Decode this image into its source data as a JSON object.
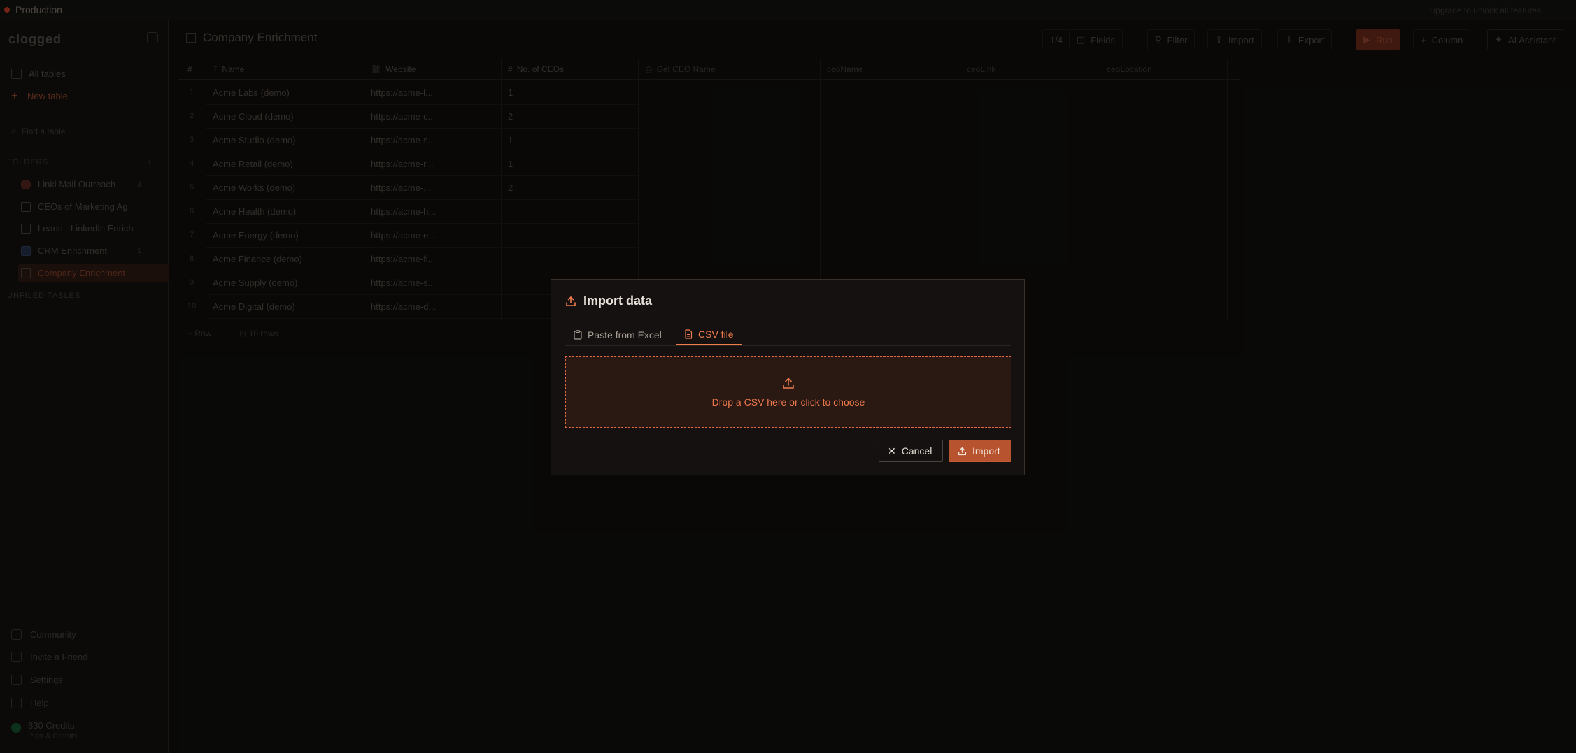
{
  "topbar": {
    "env": "Production",
    "right_info": "Upgrade to unlock all features"
  },
  "sidebar": {
    "logo": "clogged",
    "nav": [
      {
        "label": "All tables"
      },
      {
        "label": "New table",
        "icon": "+"
      }
    ],
    "search_placeholder": "Find a table",
    "folders_label": "FOLDERS",
    "folders": [
      {
        "label": "Linki Mail Outreach",
        "count": "3"
      },
      {
        "label": "CEOs of Marketing Ag"
      },
      {
        "label": "Leads - LinkedIn Enrich"
      },
      {
        "label": "CRM Enrichment",
        "count": "1"
      },
      {
        "label": "Company Enrichment"
      }
    ],
    "unfiled_label": "UNFILED TABLES",
    "bottom": [
      {
        "label": "Community"
      },
      {
        "label": "Invite a Friend"
      },
      {
        "label": "Settings"
      },
      {
        "label": "Help"
      }
    ],
    "credits": {
      "title": "830 Credits",
      "subtitle": "Plan & Credits"
    }
  },
  "main": {
    "title": "Company Enrichment",
    "toolbar": {
      "rows_label": "1/4",
      "fields_label": "Fields",
      "filter_label": "Filter",
      "import_label": "Import",
      "export_label": "Export",
      "run_label": "Run",
      "column_label": "Column",
      "ai_label": "AI Assistant"
    },
    "columns": [
      "Name",
      "Website",
      "No. of CEOs",
      "Get CEO Name",
      "ceoName",
      "ceoLink",
      "ceoLocation"
    ],
    "rows": [
      {
        "name": "Acme Labs (demo)",
        "website": "https://acme-l...",
        "ceos": "1"
      },
      {
        "name": "Acme Cloud (demo)",
        "website": "https://acme-c...",
        "ceos": "2"
      },
      {
        "name": "Acme Studio (demo)",
        "website": "https://acme-s...",
        "ceos": "1"
      },
      {
        "name": "Acme Retail (demo)",
        "website": "https://acme-r...",
        "ceos": "1"
      },
      {
        "name": "Acme Works (demo)",
        "website": "https://acme-...",
        "ceos": "2"
      },
      {
        "name": "Acme Health (demo)",
        "website": "https://acme-h...",
        "ceos": ""
      },
      {
        "name": "Acme Energy (demo)",
        "website": "https://acme-e...",
        "ceos": ""
      },
      {
        "name": "Acme Finance (demo)",
        "website": "https://acme-fi...",
        "ceos": ""
      },
      {
        "name": "Acme Supply (demo)",
        "website": "https://acme-s...",
        "ceos": ""
      },
      {
        "name": "Acme Digital (demo)",
        "website": "https://acme-d...",
        "ceos": ""
      }
    ],
    "footer": {
      "add_row": "Row",
      "row_count": "10 rows"
    }
  },
  "modal": {
    "title": "Import data",
    "tabs": [
      {
        "label": "Paste from Excel"
      },
      {
        "label": "CSV file"
      }
    ],
    "active_tab": "CSV file",
    "dropzone_text": "Drop a CSV here or click to choose",
    "cancel_label": "Cancel",
    "import_label": "Import",
    "colors": {
      "accent": "#f07b4b",
      "primary_button": "#b8532f",
      "dropzone_bg": "#2a1812"
    }
  }
}
